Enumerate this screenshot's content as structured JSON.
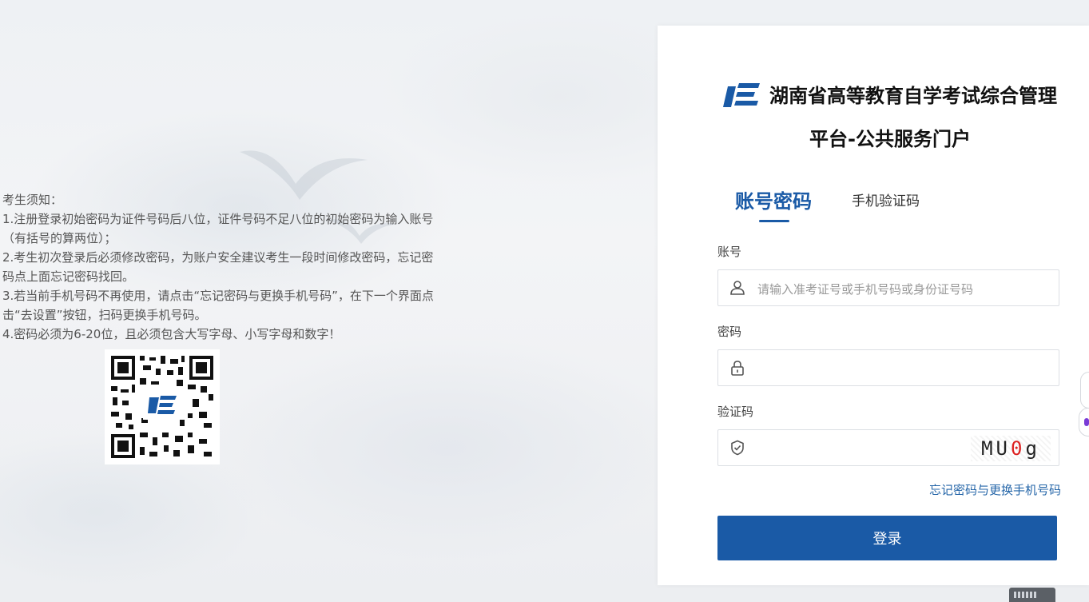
{
  "brand": {
    "title_line1": "湖南省高等教育自学考试综合管理",
    "title_line2": "平台-公共服务门户"
  },
  "notice": {
    "heading": "考生须知：",
    "lines": [
      "1.注册登录初始密码为证件号码后八位，证件号码不足八位的初始密码为输入账号（有括号的算两位）；",
      "2.考生初次登录后必须修改密码，为账户安全建议考生一段时间修改密码，忘记密码点上面忘记密码找回。",
      "3.若当前手机号码不再使用，请点击“忘记密码与更换手机号码”，在下一个界面点击“去设置”按钮，扫码更换手机号码。",
      "4.密码必须为6-20位，且必须包含大写字母、小写字母和数字！"
    ]
  },
  "tabs": {
    "account": "账号密码",
    "phone": "手机验证码",
    "active": "account"
  },
  "form": {
    "account_label": "账号",
    "account_placeholder": "请输入准考证号或手机号码或身份证号码",
    "account_value": "",
    "password_label": "密码",
    "password_value": "",
    "captcha_label": "验证码",
    "captcha_value": "",
    "captcha_image_text": {
      "part1": "MU",
      "part2": "0",
      "part3": "g"
    }
  },
  "links": {
    "forgot": "忘记密码与更换手机号码"
  },
  "buttons": {
    "login": "登录"
  },
  "colors": {
    "accent": "#1a5aa6",
    "link": "#2465a8"
  },
  "icons": {
    "account": "user-icon",
    "password": "lock-icon",
    "captcha": "shield-check-icon"
  }
}
